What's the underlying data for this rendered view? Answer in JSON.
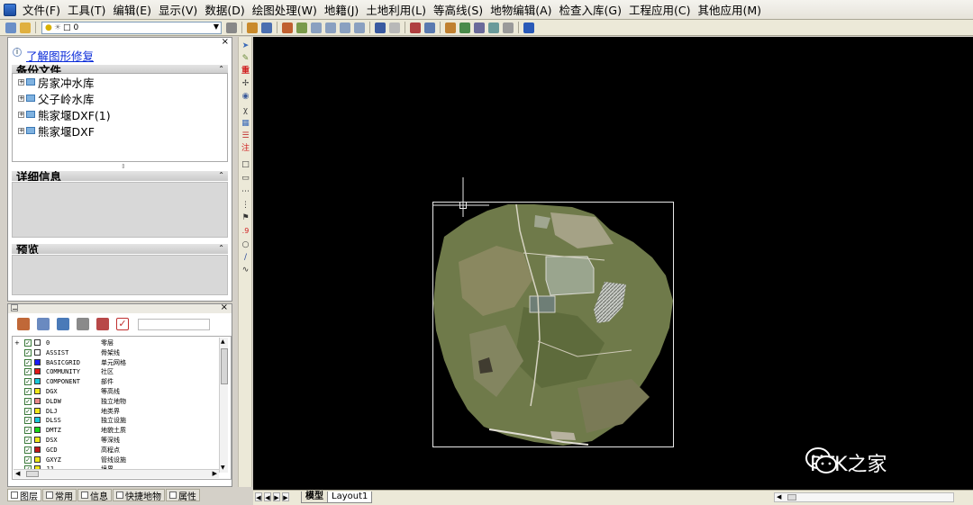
{
  "menu": [
    "文件(F)",
    "工具(T)",
    "编辑(E)",
    "显示(V)",
    "数据(D)",
    "绘图处理(W)",
    "地籍(J)",
    "土地利用(L)",
    "等高线(S)",
    "地物编辑(A)",
    "检查入库(G)",
    "工程应用(C)",
    "其他应用(M)"
  ],
  "toolbar": {
    "layer_value": "0"
  },
  "left_panel": {
    "repair_link": "了解图形修复",
    "backup": {
      "title": "备份文件",
      "items": [
        "房家冲水库",
        "父子岭水库",
        "熊家堰DXF(1)",
        "熊家堰DXF"
      ]
    },
    "details_title": "详细信息",
    "preview_title": "预览"
  },
  "layers": {
    "rows": [
      {
        "code": "0",
        "desc": "零层",
        "color": "#ffffff"
      },
      {
        "code": "ASSIST",
        "desc": "骨架线",
        "color": "#ffffff"
      },
      {
        "code": "BASICGRID",
        "desc": "单元网格",
        "color": "#1a1aff"
      },
      {
        "code": "COMMUNITY",
        "desc": "社区",
        "color": "#e01818"
      },
      {
        "code": "COMPONENT",
        "desc": "部件",
        "color": "#18c8d8"
      },
      {
        "code": "DGX",
        "desc": "等高线",
        "color": "#f0e818"
      },
      {
        "code": "DLDW",
        "desc": "独立地物",
        "color": "#e88888"
      },
      {
        "code": "DLJ",
        "desc": "地类界",
        "color": "#f0e818"
      },
      {
        "code": "DLSS",
        "desc": "独立设施",
        "color": "#18c8d8"
      },
      {
        "code": "DMTZ",
        "desc": "地貌土质",
        "color": "#18d818"
      },
      {
        "code": "DSX",
        "desc": "等深线",
        "color": "#f0e818"
      },
      {
        "code": "GCD",
        "desc": "高程点",
        "color": "#c01818"
      },
      {
        "code": "GXYZ",
        "desc": "管线设施",
        "color": "#f0e818"
      },
      {
        "code": "JJ",
        "desc": "境界",
        "color": "#f0e818"
      }
    ]
  },
  "left_tabs": [
    "图层",
    "常用",
    "信息",
    "快捷地物",
    "属性"
  ],
  "drawing_tabs": [
    "模型",
    "Layout1"
  ],
  "watermark": "RTK之家",
  "colors": {
    "canvas_bg": "#000000",
    "link": "#0a2bd9"
  },
  "icons": [
    "app-icon",
    "layer-icon",
    "bulb-icon",
    "chevron-down-icon",
    "pencil-icon",
    "zoom-icon",
    "undo-icon",
    "redo-icon",
    "help-icon",
    "folder-icon",
    "plus-icon",
    "checkbox-icon",
    "wechat-icon"
  ]
}
